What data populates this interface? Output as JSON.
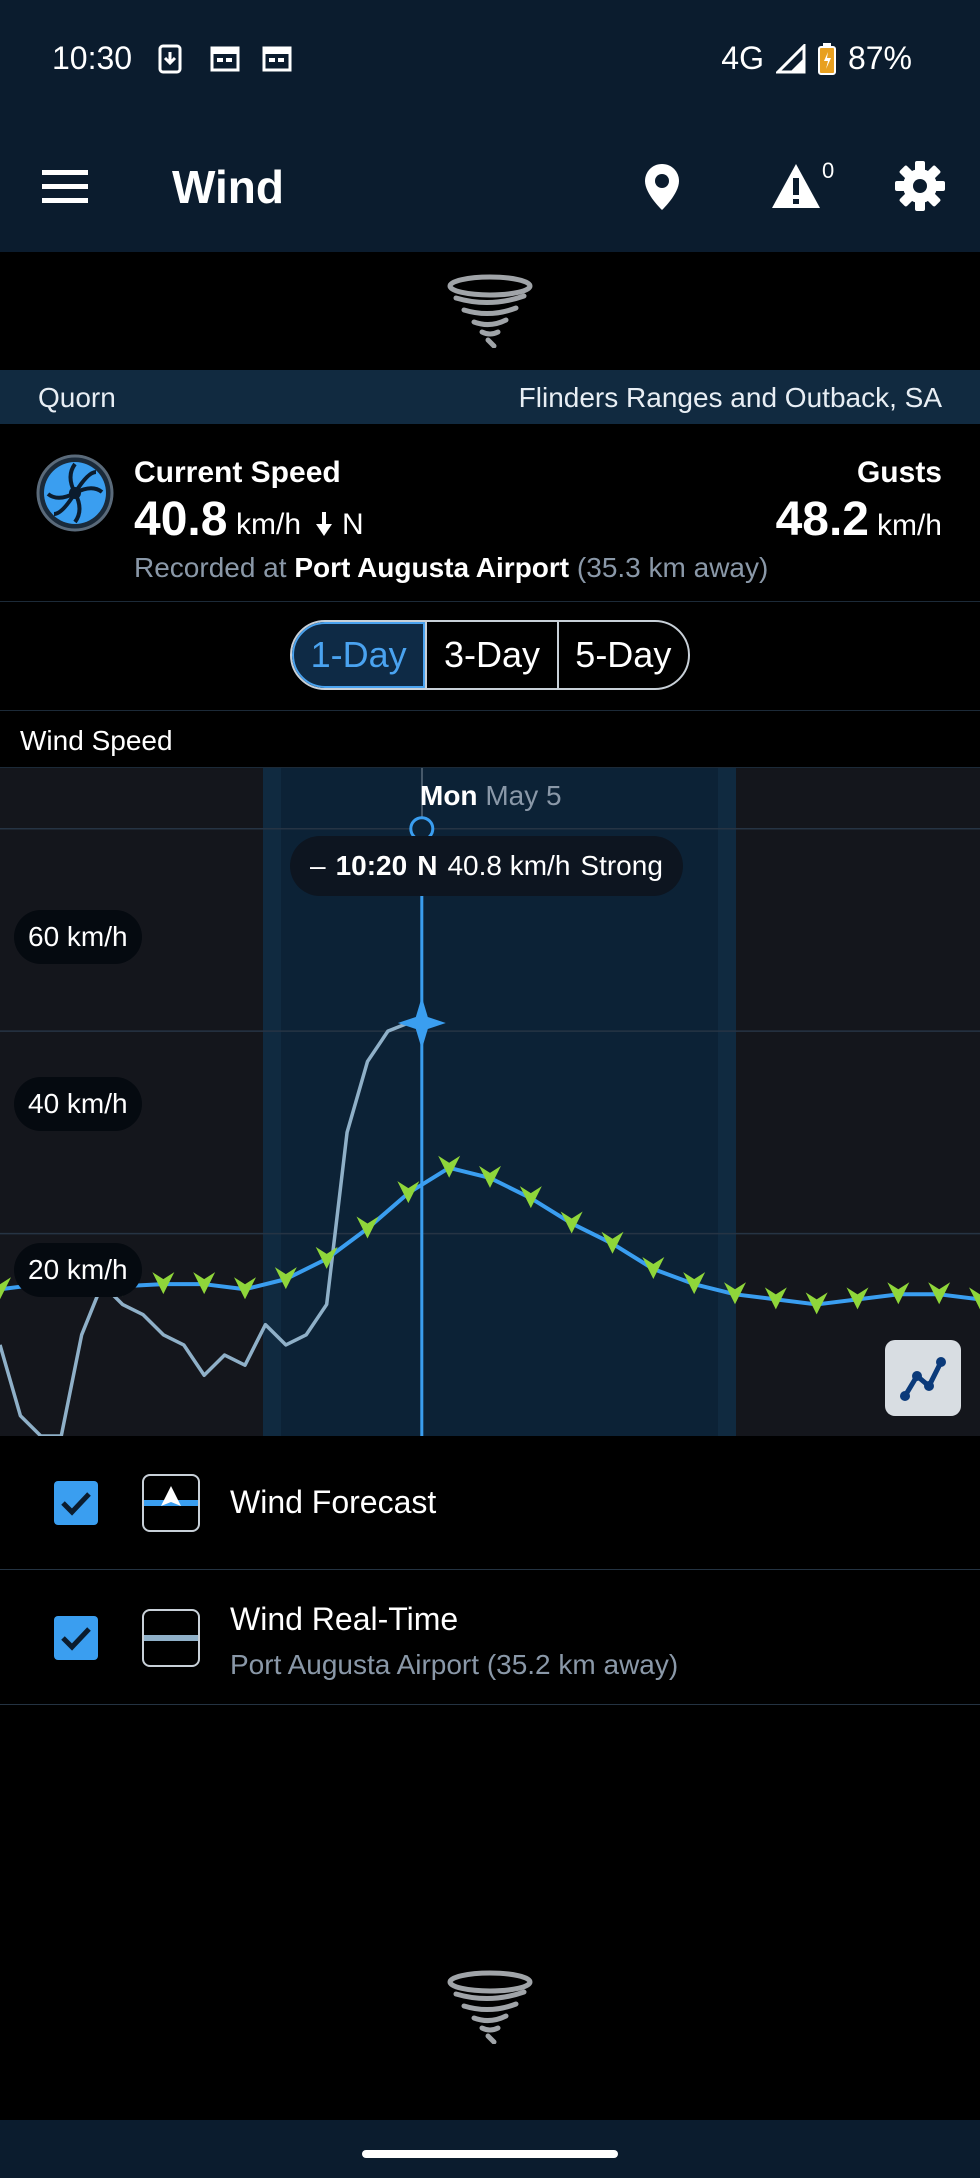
{
  "status": {
    "time": "10:30",
    "network": "4G",
    "battery": "87%"
  },
  "app_bar": {
    "title": "Wind",
    "alert_count": "0",
    "icons": [
      "menu-icon",
      "location-pin-icon",
      "alert-icon",
      "gear-icon"
    ]
  },
  "location": {
    "town": "Quorn",
    "region": "Flinders Ranges and Outback, SA"
  },
  "current": {
    "label": "Current Speed",
    "value": "40.8",
    "unit": "km/h",
    "direction": "N",
    "recorded_prefix": "Recorded at",
    "station": "Port Augusta Airport",
    "distance": "(35.3 km away)",
    "gusts_label": "Gusts",
    "gusts_value": "48.2",
    "gusts_unit": "km/h"
  },
  "range_tabs": {
    "selected": "1-Day",
    "items": [
      "1-Day",
      "3-Day",
      "5-Day"
    ]
  },
  "chart_header": {
    "title": "Wind Speed"
  },
  "chart_data": {
    "type": "line",
    "day": "Mon",
    "date": "May 5",
    "tooltip": {
      "time": "10:20",
      "direction": "N",
      "speed": "40.8 km/h",
      "description": "Strong"
    },
    "y_ticks": [
      "60 km/h",
      "40 km/h",
      "20 km/h"
    ],
    "ylim": [
      0,
      66
    ],
    "colors": {
      "forecast": "#3a9ef0",
      "forecast_markers": "#8fd63a",
      "realtime": "#8fb0c8",
      "highlight": "#0e2a45"
    },
    "series": [
      {
        "name": "Wind Forecast",
        "x": [
          0,
          1,
          2,
          3,
          4,
          5,
          6,
          7,
          8,
          9,
          10,
          11,
          12,
          13,
          14,
          15,
          16,
          17,
          18,
          19,
          20,
          21,
          22,
          23,
          24
        ],
        "values": [
          14.5,
          15,
          15.2,
          14.8,
          15,
          15,
          14.5,
          15.5,
          17.5,
          20.5,
          24,
          26.5,
          25.5,
          23.5,
          21,
          19,
          16.5,
          15,
          14,
          13.5,
          13,
          13.5,
          14,
          14,
          13.5
        ]
      },
      {
        "name": "Wind Real-Time",
        "x": [
          0,
          0.5,
          1,
          1.5,
          2,
          2.5,
          3,
          3.5,
          4,
          4.5,
          5,
          5.5,
          6,
          6.5,
          7,
          7.5,
          8,
          8.5,
          9,
          9.5,
          10,
          10.33
        ],
        "values": [
          9,
          2,
          0,
          0,
          10,
          15,
          13,
          12,
          10,
          9,
          6,
          8,
          7,
          11,
          9,
          10,
          13,
          30,
          37,
          40,
          40.8,
          40.8
        ]
      }
    ]
  },
  "legend": [
    {
      "name": "Wind Forecast",
      "checked": true,
      "sub": ""
    },
    {
      "name": "Wind Real-Time",
      "checked": true,
      "sub": "Port Augusta Airport (35.2 km away)"
    }
  ]
}
